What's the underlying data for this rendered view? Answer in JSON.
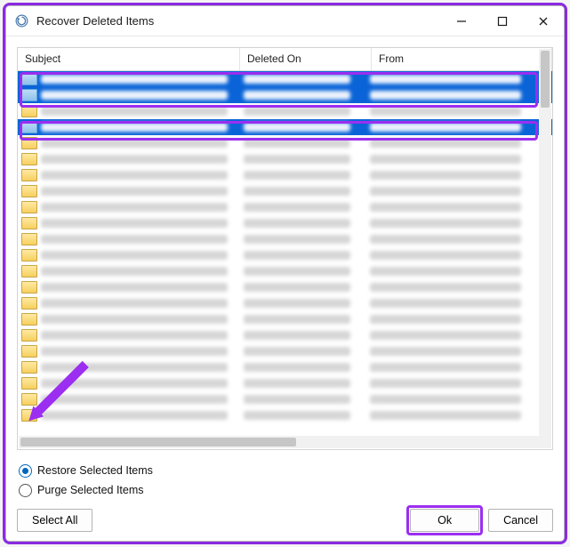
{
  "title": "Recover Deleted Items",
  "columns": {
    "subject": "Subject",
    "deletedOn": "Deleted On",
    "from": "From"
  },
  "radios": {
    "restore": "Restore Selected Items",
    "purge": "Purge Selected Items",
    "selected": "restore"
  },
  "buttons": {
    "selectAll": "Select All",
    "ok": "Ok",
    "cancel": "Cancel"
  },
  "selectedRowIndices": [
    0,
    1,
    3
  ]
}
